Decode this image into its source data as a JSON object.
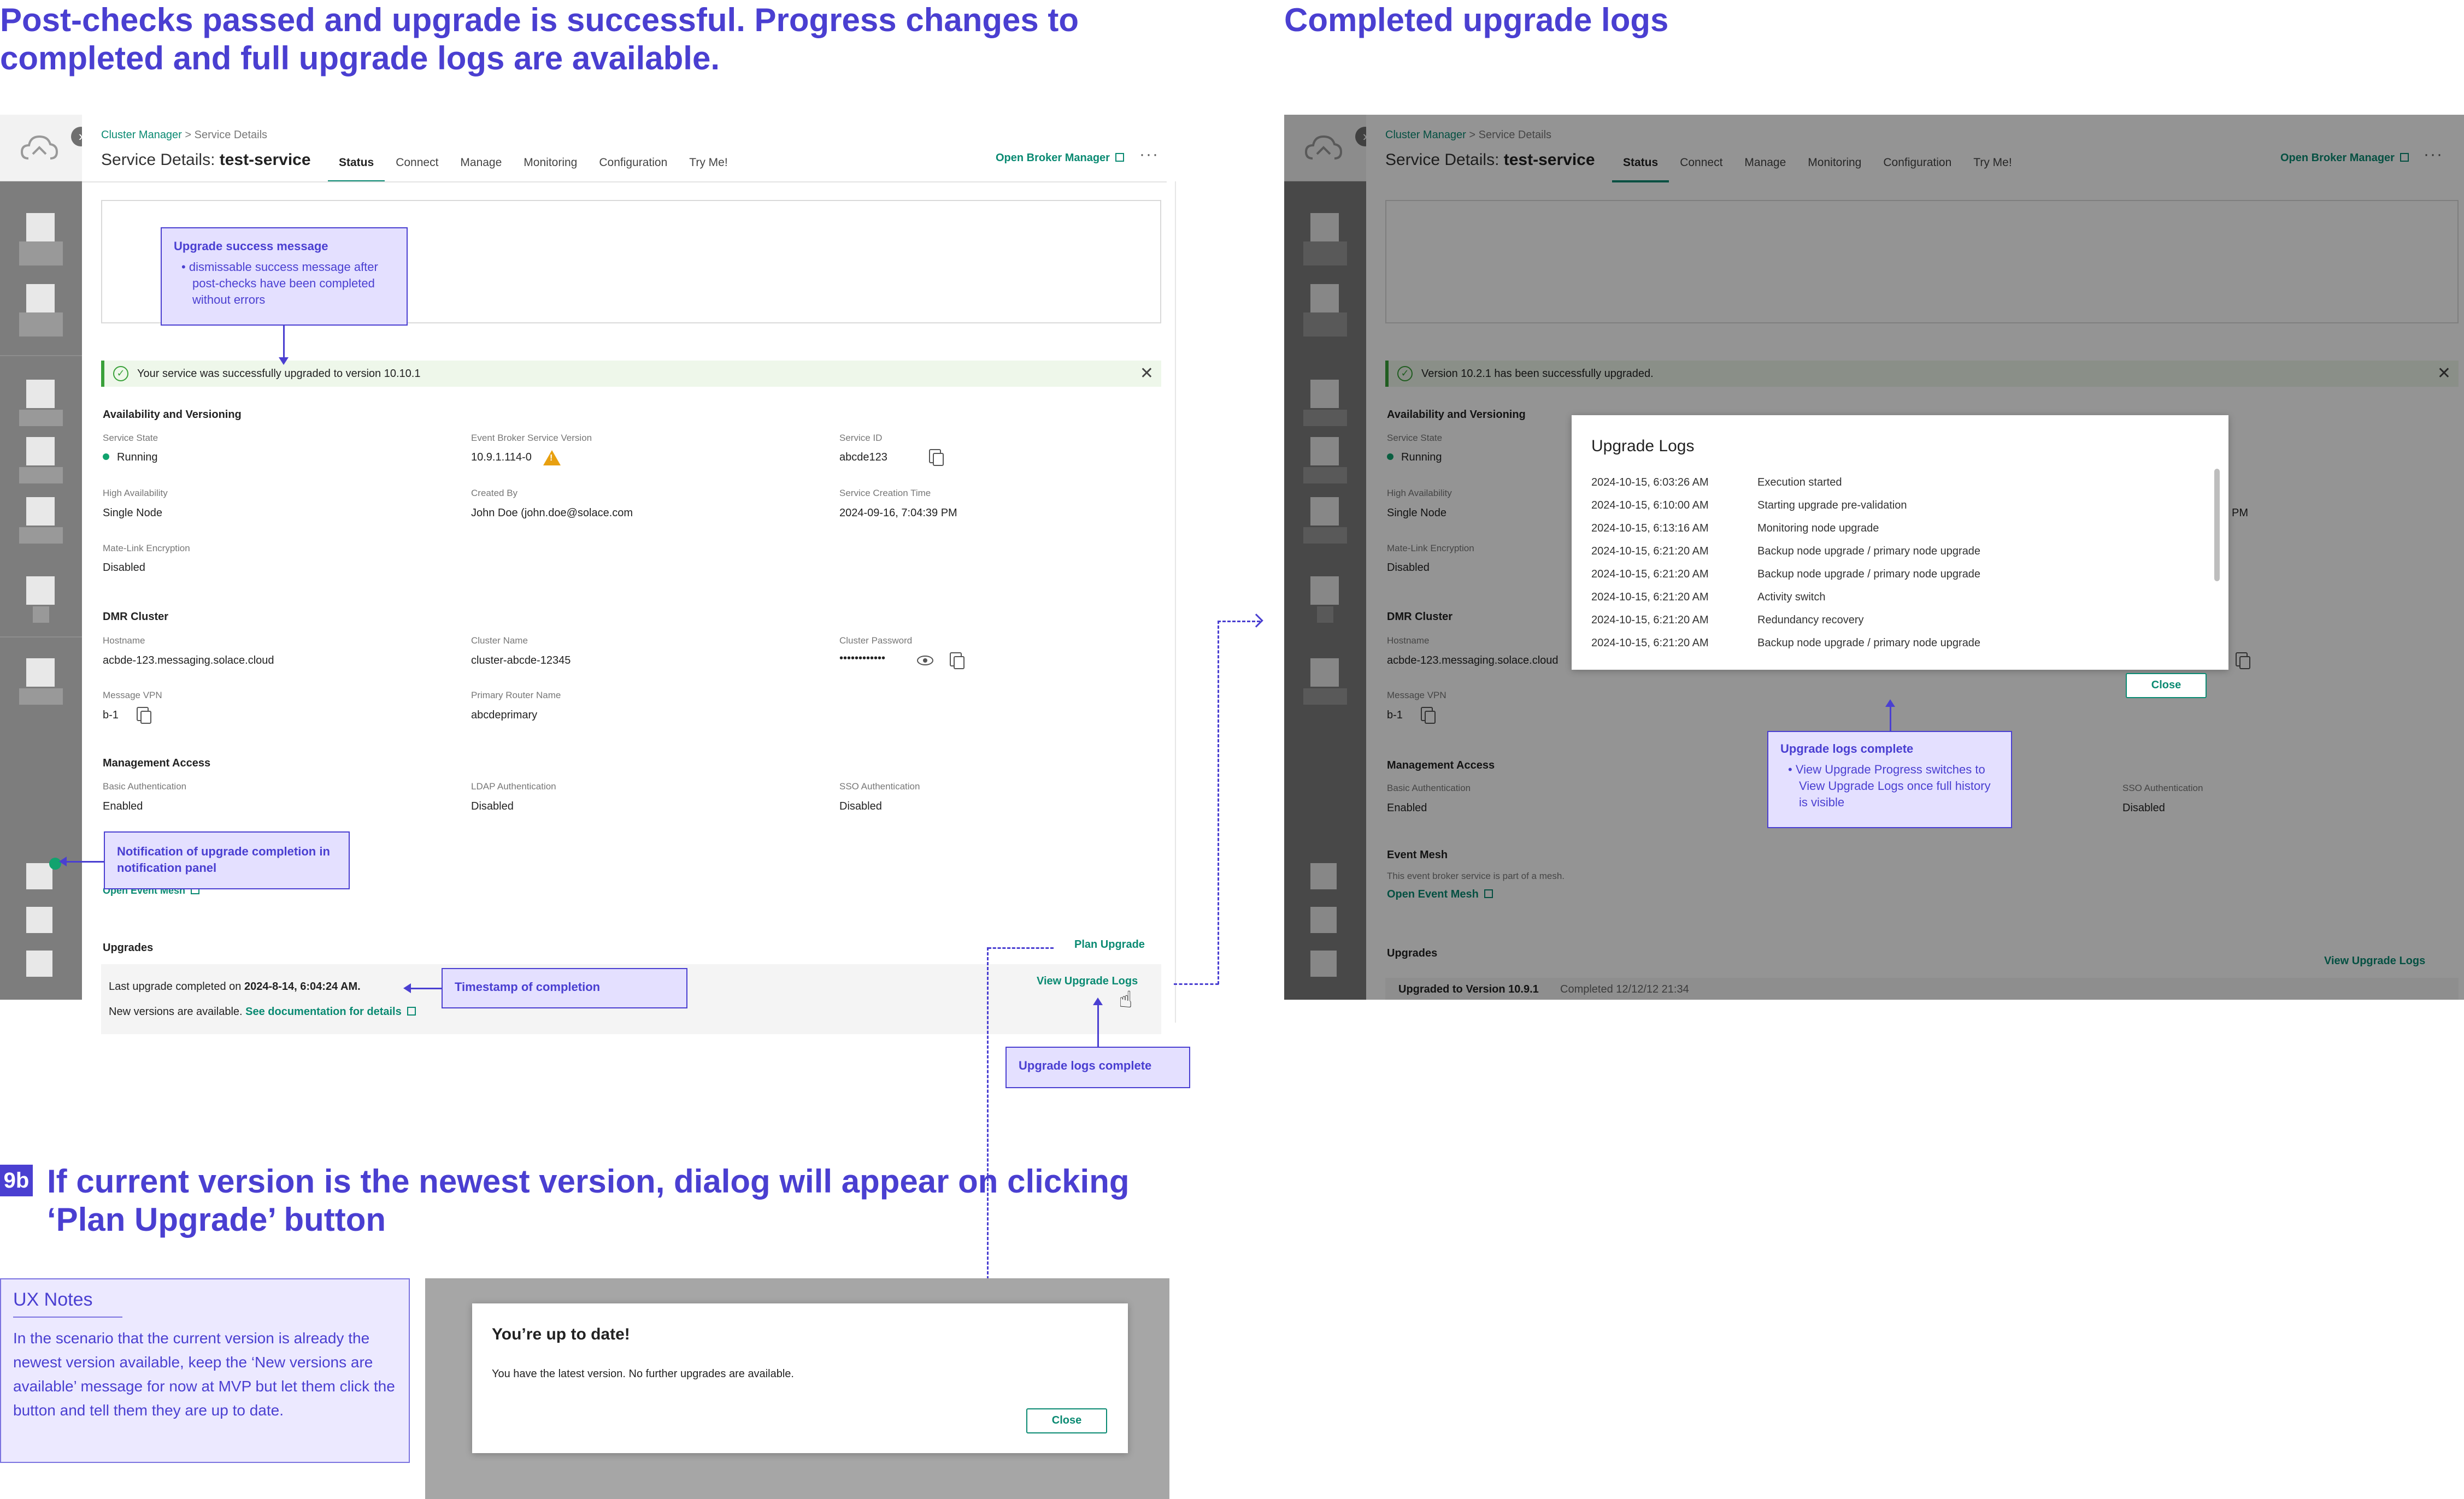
{
  "headings": {
    "main_line1": "Post-checks passed and upgrade is successful. Progress changes to",
    "main_line2": "completed and full upgrade logs are available.",
    "right": "Completed upgrade logs",
    "step_badge": "9b",
    "step_line1": "If current version is the newest version, dialog will appear on clicking",
    "step_line2": "‘Plan Upgrade’ button"
  },
  "breadcrumb": {
    "root": "Cluster Manager",
    "separator": " > ",
    "current": "Service Details"
  },
  "service": {
    "title_prefix": "Service Details: ",
    "title_name": "test-service"
  },
  "tabs": [
    "Status",
    "Connect",
    "Manage",
    "Monitoring",
    "Configuration",
    "Try Me!"
  ],
  "header": {
    "broker_manager": "Open Broker Manager",
    "more": "···"
  },
  "banner_left": {
    "message": "Your service was successfully upgraded to version 10.10.1",
    "close": "✕"
  },
  "banner_right": {
    "message": "Version 10.2.1 has been successfully upgraded.",
    "close": "✕"
  },
  "availability": {
    "title": "Availability and Versioning",
    "service_state_label": "Service State",
    "service_state": "Running",
    "broker_version_label": "Event Broker Service Version",
    "broker_version": "10.9.1.114-0",
    "service_id_label": "Service ID",
    "service_id": "abcde123",
    "high_availability_label": "High Availability",
    "high_availability": "Single Node",
    "created_by_label": "Created By",
    "created_by": "John Doe (john.doe@solace.com",
    "creation_time_label": "Service Creation Time",
    "creation_time": "2024-09-16, 7:04:39 PM",
    "mate_link_label": "Mate-Link Encryption",
    "mate_link": "Disabled"
  },
  "dmr": {
    "title": "DMR Cluster",
    "hostname_label": "Hostname",
    "hostname": "acbde-123.messaging.solace.cloud",
    "cluster_name_label": "Cluster Name",
    "cluster_name": "cluster-abcde-12345",
    "cluster_password_label": "Cluster Password",
    "cluster_password": "••••••••••••",
    "message_vpn_label": "Message VPN",
    "message_vpn": "b-1",
    "primary_router_label": "Primary Router Name",
    "primary_router": "abcdeprimary"
  },
  "management": {
    "title": "Management Access",
    "basic_label": "Basic Authentication",
    "basic": "Enabled",
    "ldap_label": "LDAP Authentication",
    "ldap": "Disabled",
    "sso_label": "SSO Authentication",
    "sso": "Disabled"
  },
  "event_mesh": {
    "title": "Event Mesh",
    "description": "This event broker service is part of a mesh.",
    "link": "Open Event Mesh"
  },
  "upgrades": {
    "title": "Upgrades",
    "plan_upgrade": "Plan Upgrade",
    "last_upgrade_prefix": "Last upgrade completed on ",
    "last_upgrade_time": "2024-8-14, 6:04:24 AM.",
    "new_versions": "New versions are available. ",
    "docs_link": "See documentation for details",
    "view_logs": "View Upgrade Logs",
    "right_row_version": "Upgraded  to Version 10.9.1",
    "right_row_completed": "Completed 12/12/12 21:34"
  },
  "annotations": {
    "success_title": "Upgrade success message",
    "success_bullet": "dismissable success message after post-checks have been completed without errors",
    "notification": "Notification of upgrade completion in notification panel",
    "timestamp": "Timestamp of completion",
    "logs_complete": "Upgrade logs complete",
    "logs_complete_right_title": "Upgrade logs complete",
    "logs_complete_right_bullet": "View Upgrade Progress switches to View Upgrade Logs once full history is visible"
  },
  "logs_modal": {
    "title": "Upgrade Logs",
    "rows": [
      {
        "time": "2024-10-15, 6:03:26 AM",
        "event": "Execution started"
      },
      {
        "time": "2024-10-15, 6:10:00 AM",
        "event": "Starting upgrade pre-validation"
      },
      {
        "time": "2024-10-15, 6:13:16 AM",
        "event": "Monitoring node upgrade"
      },
      {
        "time": "2024-10-15, 6:21:20 AM",
        "event": "Backup node upgrade / primary node upgrade"
      },
      {
        "time": "2024-10-15, 6:21:20 AM",
        "event": "Backup node upgrade / primary node upgrade"
      },
      {
        "time": "2024-10-15, 6:21:20 AM",
        "event": "Activity switch"
      },
      {
        "time": "2024-10-15, 6:21:20 AM",
        "event": "Redundancy recovery"
      },
      {
        "time": "2024-10-15, 6:21:20 AM",
        "event": "Backup node upgrade / primary node upgrade"
      }
    ],
    "close": "Close",
    "peek_pm": "PM"
  },
  "ux_notes": {
    "title": "UX Notes",
    "text": "In the scenario that the current version is already the newest version available, keep the ‘New versions are available’ message for now at MVP but let them click the button and tell them they are up to date."
  },
  "uptodate_modal": {
    "title": "You’re up to date!",
    "message": "You have the latest version. No further upgrades are available.",
    "close": "Close"
  },
  "colors": {
    "accent": "#4a3fd1",
    "brand_green": "#0a8a72",
    "success": "#3aa13a",
    "warning": "#e8a010"
  }
}
